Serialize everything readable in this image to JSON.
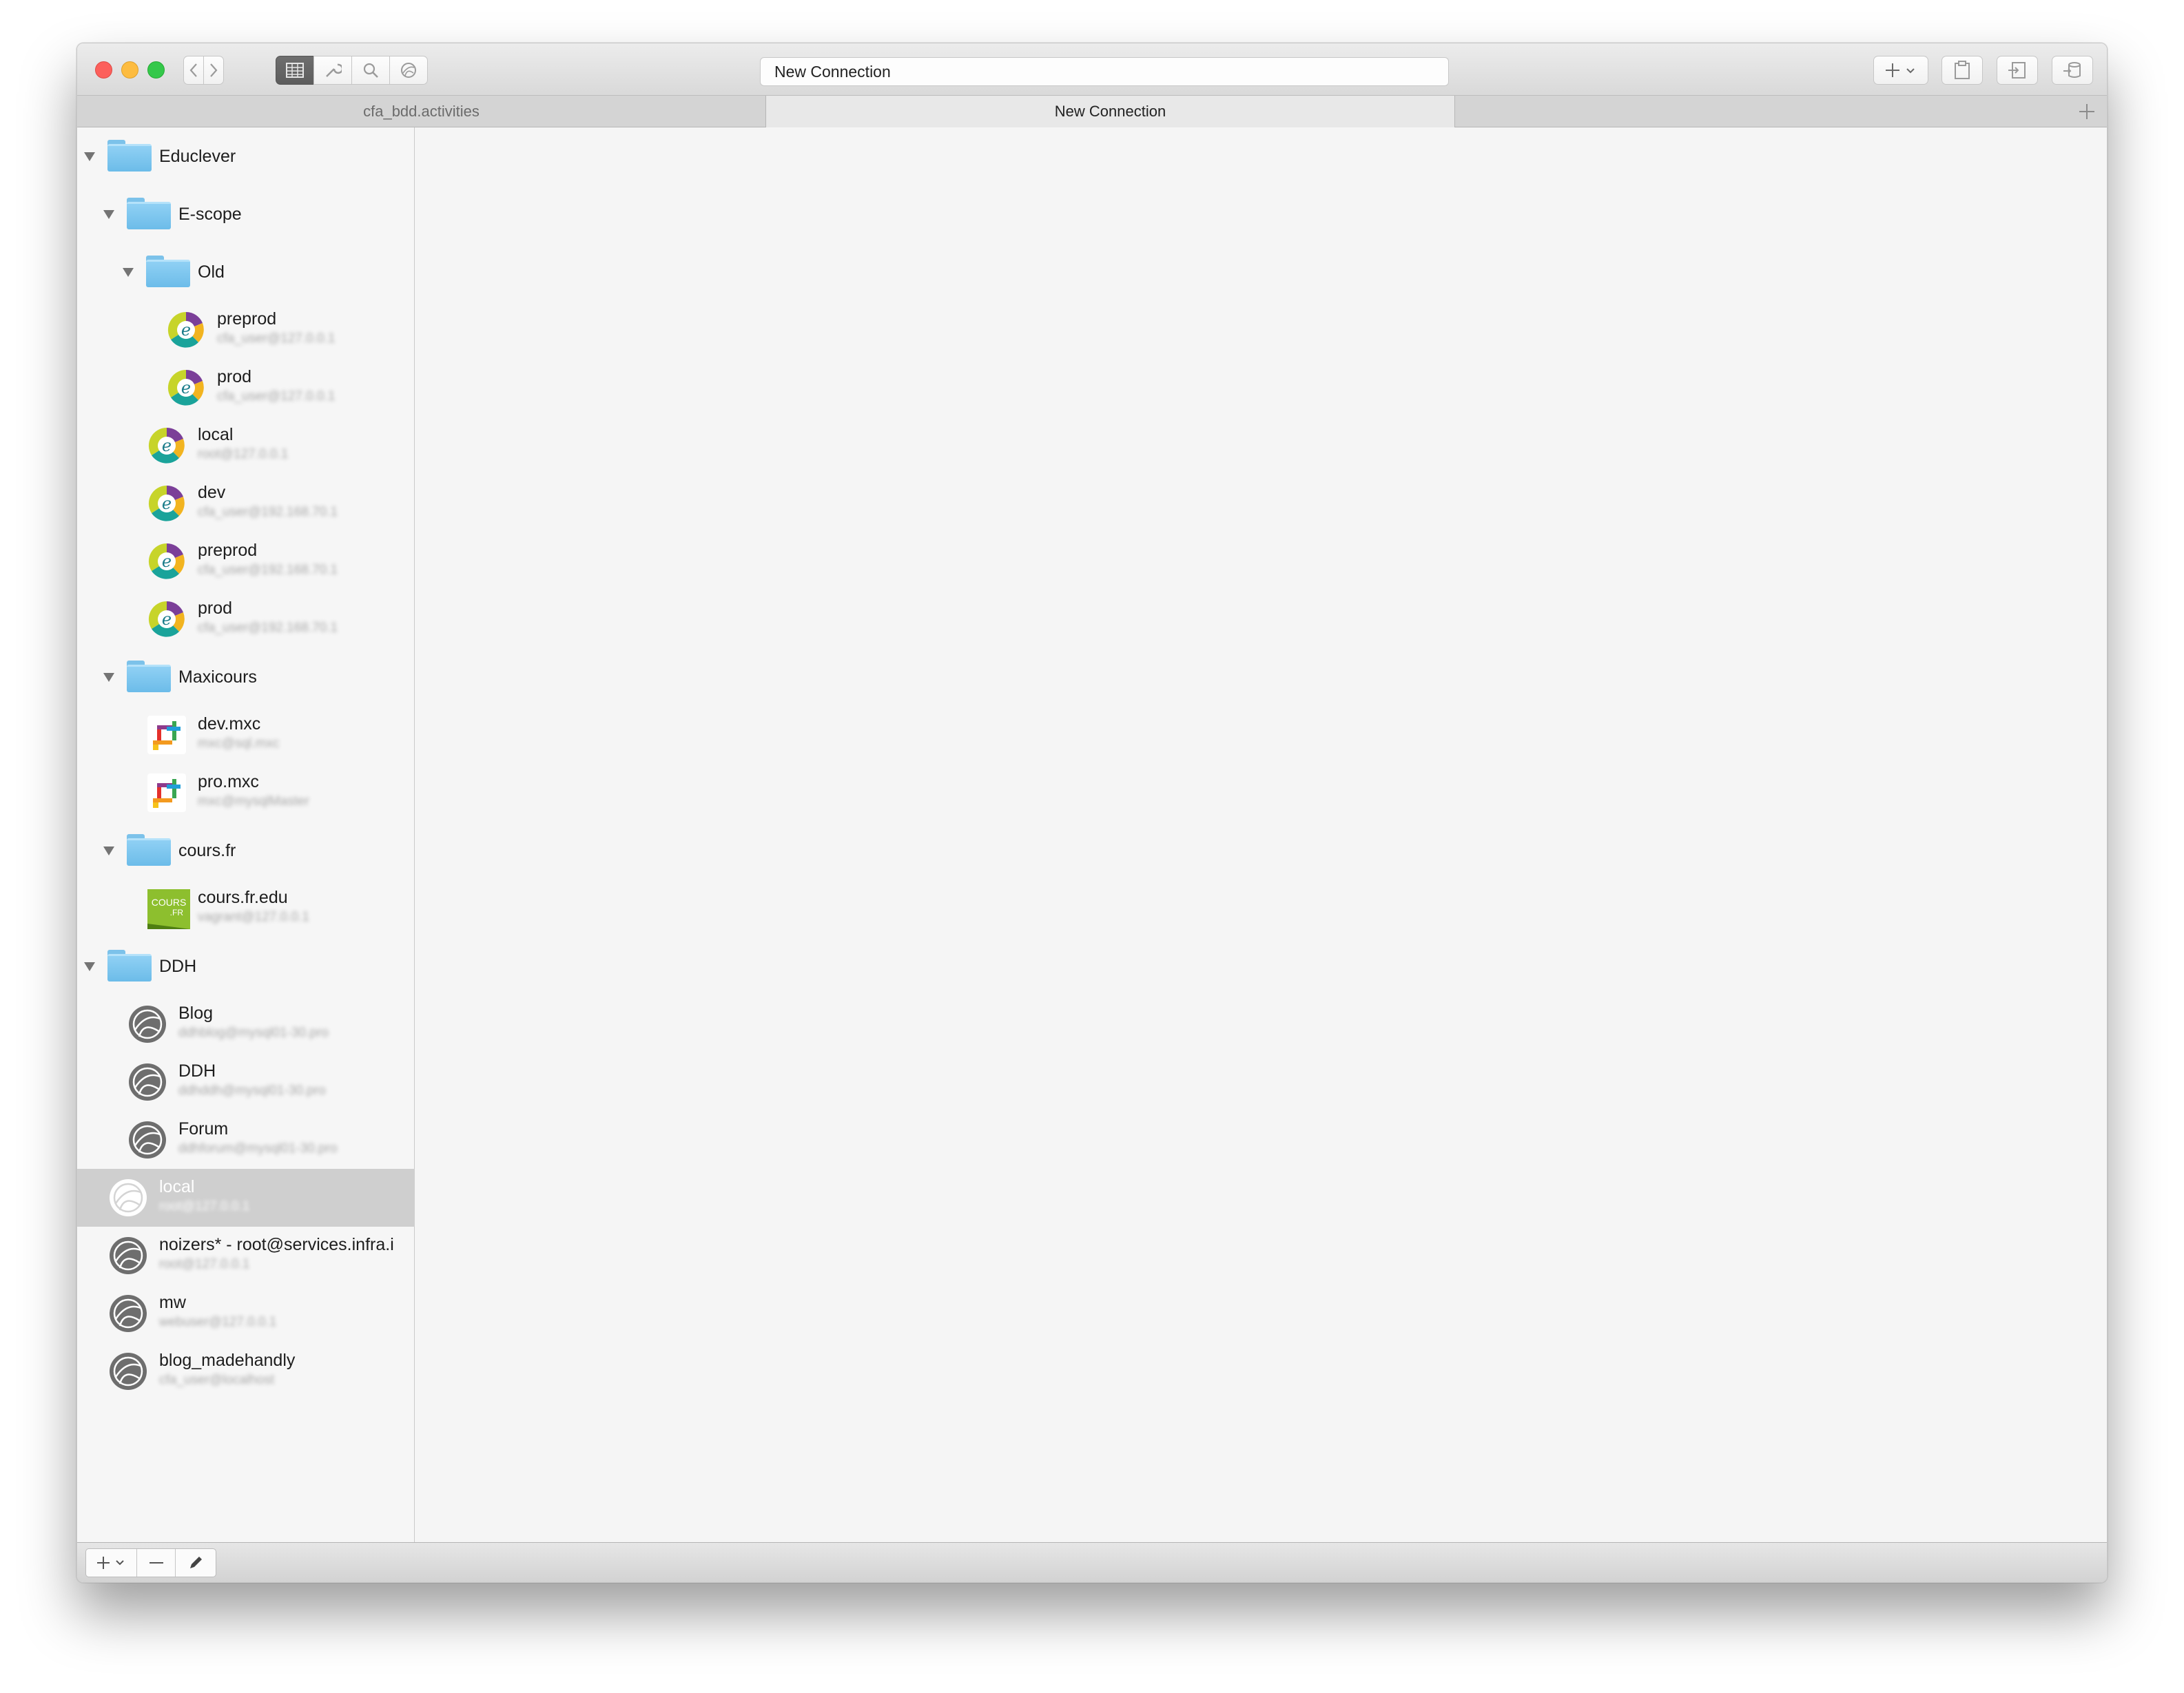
{
  "window": {
    "address": "New Connection"
  },
  "tabs": [
    {
      "label": "cfa_bdd.activities",
      "active": false
    },
    {
      "label": "New Connection",
      "active": true
    }
  ],
  "sidebar": {
    "items": [
      {
        "label": "Educlever",
        "type": "folder"
      },
      {
        "label": "E-scope",
        "type": "folder"
      },
      {
        "label": "Old",
        "type": "folder"
      },
      {
        "label": "preprod",
        "sub": "cfa_user@127.0.0.1",
        "icon": "educlever-logo-icon"
      },
      {
        "label": "prod",
        "sub": "cfa_user@127.0.0.1",
        "icon": "educlever-logo-icon"
      },
      {
        "label": "local",
        "sub": "root@127.0.0.1",
        "icon": "educlever-logo-icon"
      },
      {
        "label": "dev",
        "sub": "cfa_user@192.168.70.1",
        "icon": "educlever-logo-icon"
      },
      {
        "label": "preprod",
        "sub": "cfa_user@192.168.70.1",
        "icon": "educlever-logo-icon"
      },
      {
        "label": "prod",
        "sub": "cfa_user@192.168.70.1",
        "icon": "educlever-logo-icon"
      },
      {
        "label": "Maxicours",
        "type": "folder"
      },
      {
        "label": "dev.mxc",
        "sub": "mxc@sql.mxc",
        "icon": "maxicours-logo-icon"
      },
      {
        "label": "pro.mxc",
        "sub": "mxc@mysqlMaster",
        "icon": "maxicours-logo-icon"
      },
      {
        "label": "cours.fr",
        "type": "folder"
      },
      {
        "label": "cours.fr.edu",
        "sub": "vagrant@127.0.0.1",
        "icon": "coursfr-logo-icon",
        "logo_text": "COURS.FR"
      },
      {
        "label": "DDH",
        "type": "folder"
      },
      {
        "label": "Blog",
        "sub": "ddhblog@mysql01-30.pro",
        "icon": "globe-icon"
      },
      {
        "label": "DDH",
        "sub": "ddhddh@mysql01-30.pro",
        "icon": "globe-icon"
      },
      {
        "label": "Forum",
        "sub": "ddhforum@mysql01-30.pro",
        "icon": "globe-icon"
      },
      {
        "label": "local",
        "sub": "root@127.0.0.1",
        "icon": "globe-icon",
        "selected": true
      },
      {
        "label": "noizers* - root@services.infra.i",
        "sub": "root@127.0.0.1",
        "icon": "globe-icon"
      },
      {
        "label": "mw",
        "sub": "webuser@127.0.0.1",
        "icon": "globe-icon"
      },
      {
        "label": "blog_madehandly",
        "sub": "cfa_user@localhost",
        "icon": "globe-icon"
      }
    ]
  },
  "colors": {
    "folder": "#7cc2ea",
    "selection": "#cfcfcf",
    "close": "#fc605c",
    "minimize": "#fdbc40",
    "zoom": "#34c84a"
  }
}
